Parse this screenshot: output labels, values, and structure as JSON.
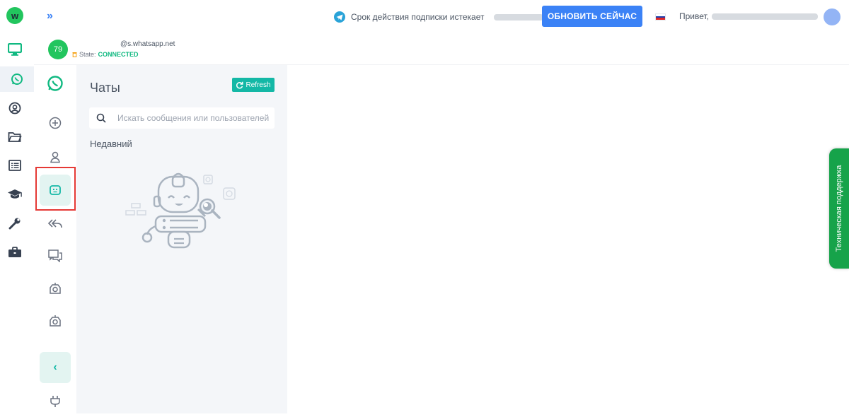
{
  "app": {
    "logo_letter": "w"
  },
  "header": {
    "subscription_text": "Срок действия подписки истекает",
    "renew_button": "ОБНОВИТЬ СЕЙЧАС",
    "greeting": "Привет,"
  },
  "account": {
    "avatar_text": "79",
    "id_suffix": "@s.whatsapp.net",
    "state_label": "State:",
    "state_value": "CONNECTED"
  },
  "chats": {
    "title": "Чаты",
    "refresh_label": "Refresh",
    "search_placeholder": "Искать сообщения или пользователей",
    "recent_label": "Недавний"
  },
  "support": {
    "label": "Техническая поддержка"
  },
  "colors": {
    "brand_green": "#22c55e",
    "teal": "#14b8a6",
    "blue": "#3b82f6",
    "state_green": "#10b981"
  },
  "icons": {
    "rail": [
      "monitor-icon",
      "whatsapp-icon",
      "user-circle-icon",
      "folder-icon",
      "list-icon",
      "graduation-cap-icon",
      "wrench-icon",
      "briefcase-icon"
    ],
    "col2": [
      "whatsapp-icon",
      "plus-circle-icon",
      "contact-icon",
      "bot-icon",
      "reply-all-icon",
      "chat-bubbles-icon",
      "camera-icon",
      "camera-icon",
      "plug-icon"
    ]
  }
}
